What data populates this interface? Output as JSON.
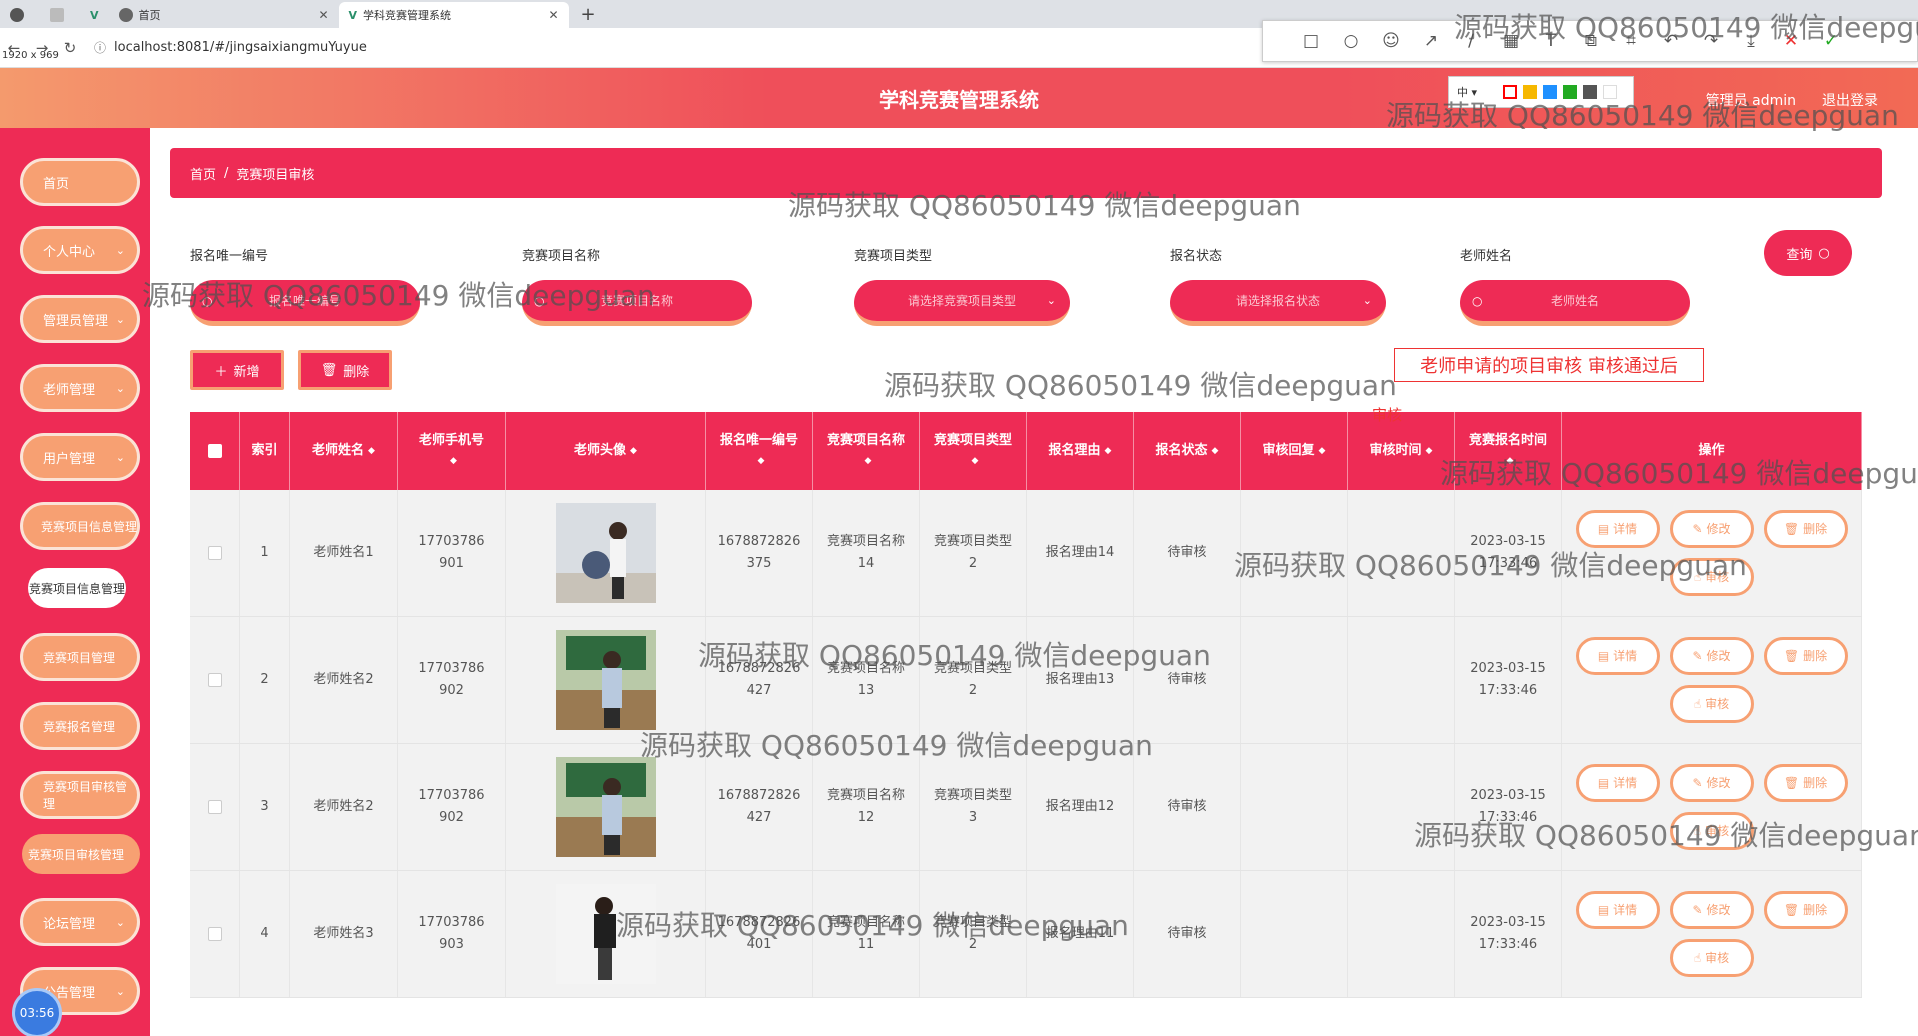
{
  "browser": {
    "tabs": [
      {
        "label": "首页"
      },
      {
        "label": "学科竞赛管理系统"
      }
    ],
    "url": "localhost:8081/#/jingsaixiangmuYuyue",
    "dims": "1920 x 969"
  },
  "snaptool": {
    "fontsize": "中 ▾",
    "colors": [
      "#ff0000",
      "#f6b800",
      "#1e90ff",
      "#22aa22",
      "#555555",
      "#ffffff"
    ]
  },
  "header": {
    "title": "学科竞赛管理系统",
    "user": "管理员 admin",
    "logout": "退出登录"
  },
  "sidebar": {
    "items": [
      "首页",
      "个人中心",
      "管理员管理",
      "老师管理",
      "用户管理",
      "竞赛项目信息管理",
      "竞赛项目信息管理",
      "竞赛项目管理",
      "竞赛报名管理",
      "竞赛项目审核管理",
      "竞赛项目审核管理",
      "论坛管理",
      "公告管理"
    ],
    "clock": "03:56"
  },
  "breadcrumb": {
    "home": "首页",
    "sep": "/",
    "current": "竞赛项目审核"
  },
  "filters": {
    "f1": {
      "label": "报名唯一编号",
      "placeholder": "报名唯一编号"
    },
    "f2": {
      "label": "竞赛项目名称",
      "placeholder": "竞赛项目名称"
    },
    "f3": {
      "label": "竞赛项目类型",
      "placeholder": "请选择竞赛项目类型"
    },
    "f4": {
      "label": "报名状态",
      "placeholder": "请选择报名状态"
    },
    "f5": {
      "label": "老师姓名",
      "placeholder": "老师姓名"
    },
    "query": "查询"
  },
  "actions": {
    "add": "新增",
    "delete": "删除"
  },
  "annotation": {
    "line1": "老师申请的项目审核 审核通过后",
    "line2": "审核"
  },
  "table": {
    "headers": {
      "index": "索引",
      "teacher": "老师姓名",
      "phone": "老师手机号",
      "avatar": "老师头像",
      "regno": "报名唯一编号",
      "pname": "竞赛项目名称",
      "ptype": "竞赛项目类型",
      "reason": "报名理由",
      "status": "报名状态",
      "reply": "审核回复",
      "rtime": "审核时间",
      "stime": "竞赛报名时间",
      "ops": "操作"
    },
    "ops": {
      "detail": "详情",
      "edit": "修改",
      "del": "删除",
      "audit": "审核"
    },
    "rows": [
      {
        "index": "1",
        "teacher": "老师姓名1",
        "phone": "17703786901",
        "regno": "1678872826375",
        "pname": "竞赛项目名称14",
        "ptype": "竞赛项目类型2",
        "reason": "报名理由14",
        "status": "待审核",
        "reply": "",
        "rtime": "",
        "stime_d": "2023-03-15",
        "stime_t": "17:33:46"
      },
      {
        "index": "2",
        "teacher": "老师姓名2",
        "phone": "17703786902",
        "regno": "1678872826427",
        "pname": "竞赛项目名称13",
        "ptype": "竞赛项目类型2",
        "reason": "报名理由13",
        "status": "待审核",
        "reply": "",
        "rtime": "",
        "stime_d": "2023-03-15",
        "stime_t": "17:33:46"
      },
      {
        "index": "3",
        "teacher": "老师姓名2",
        "phone": "17703786902",
        "regno": "1678872826427",
        "pname": "竞赛项目名称12",
        "ptype": "竞赛项目类型3",
        "reason": "报名理由12",
        "status": "待审核",
        "reply": "",
        "rtime": "",
        "stime_d": "2023-03-15",
        "stime_t": "17:33:46"
      },
      {
        "index": "4",
        "teacher": "老师姓名3",
        "phone": "17703786903",
        "regno": "1678872826401",
        "pname": "竞赛项目名称11",
        "ptype": "竞赛项目类型2",
        "reason": "报名理由11",
        "status": "待审核",
        "reply": "",
        "rtime": "",
        "stime_d": "2023-03-15",
        "stime_t": "17:33:46"
      }
    ]
  },
  "watermark": "源码获取 QQ86050149 微信deepguan"
}
